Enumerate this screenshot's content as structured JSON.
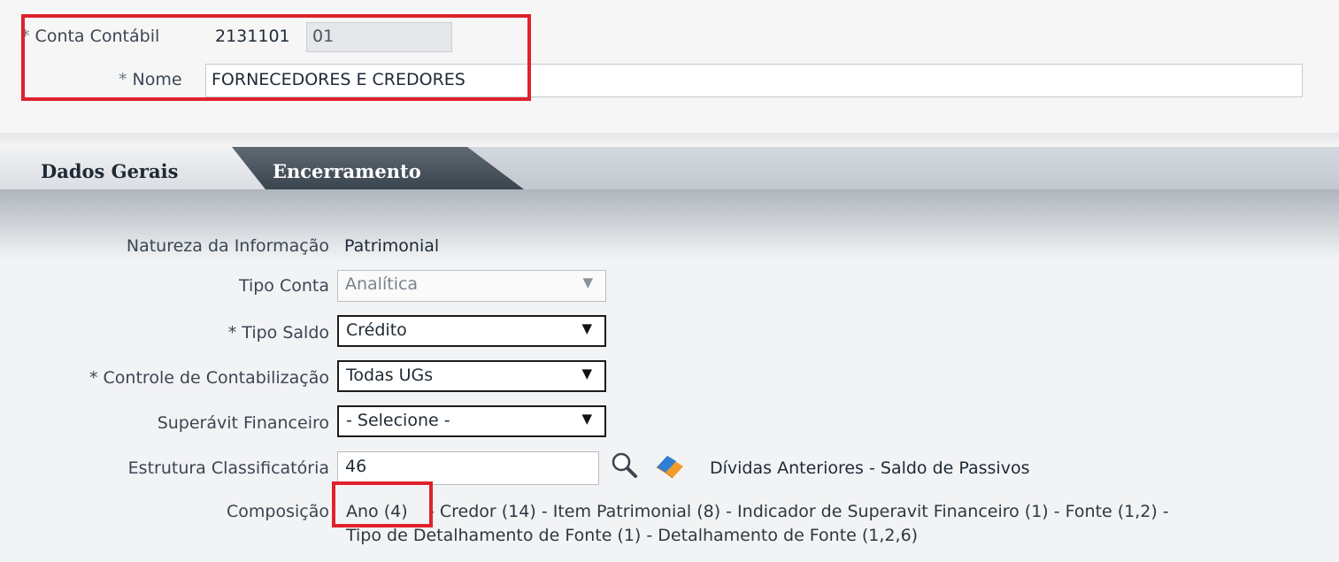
{
  "header": {
    "conta_label": "Conta Contábil",
    "conta_codigo": "2131101",
    "conta_sub": "01",
    "nome_label": "Nome",
    "nome_value": "FORNECEDORES E CREDORES",
    "required_mark": "*"
  },
  "tabs": [
    {
      "label": "Dados Gerais",
      "active": true
    },
    {
      "label": "Encerramento",
      "active": false
    }
  ],
  "form": {
    "natureza_label": "Natureza da Informação",
    "natureza_value": "Patrimonial",
    "tipo_conta_label": "Tipo Conta",
    "tipo_conta_value": "Analítica",
    "tipo_saldo_label": "* Tipo Saldo",
    "tipo_saldo_value": "Crédito",
    "controle_label": "* Controle de Contabilização",
    "controle_value": "Todas UGs",
    "superavit_label": "Superávit Financeiro",
    "superavit_value": "- Selecione -",
    "estrutura_label": "Estrutura Classificatória",
    "estrutura_value": "46",
    "estrutura_desc": "Dívidas Anteriores - Saldo de Passivos",
    "composicao_label": "Composição",
    "composicao_first": "Ano (4)",
    "composicao_rest_line1": "- Credor (14) - Item Patrimonial (8) - Indicador de Superavit Financeiro (1) - Fonte (1,2) -",
    "composicao_line2": "Tipo de Detalhamento de Fonte (1) - Detalhamento de Fonte (1,2,6)"
  },
  "colors": {
    "highlight_red": "#e0222d",
    "tab_inactive": "#3a444d"
  },
  "icons": {
    "search": "magnifier-icon",
    "clear": "eraser-icon"
  }
}
